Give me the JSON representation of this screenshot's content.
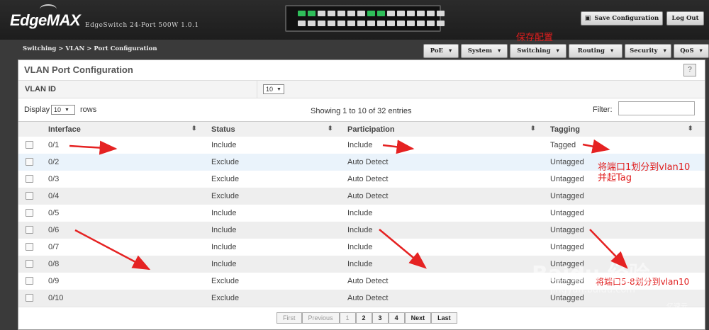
{
  "header": {
    "logo": "EdgeMAX",
    "model": "EdgeSwitch 24-Port 500W 1.0.1",
    "save_label": "Save Configuration",
    "logout_label": "Log Out",
    "save_icon": "floppy-disk-icon",
    "switch_ports_top": [
      1,
      1,
      0,
      0,
      0,
      0,
      0,
      1,
      1,
      0,
      0,
      0,
      0,
      0,
      0
    ],
    "accent_port_color": "#2fbf5a"
  },
  "annotations": {
    "save": "保存配置",
    "port1_line1": "将端口1划分到vlan10",
    "port1_line2": "并起Tag",
    "ports_range": "将端口5-8划分到vlan10"
  },
  "breadcrumb": {
    "a": "Switching",
    "sep1": ">",
    "b": "VLAN",
    "sep2": ">",
    "c": "Port Configuration"
  },
  "menu": [
    {
      "label": "PoE"
    },
    {
      "label": "System"
    },
    {
      "label": "Switching"
    },
    {
      "label": "Routing"
    },
    {
      "label": "Security"
    },
    {
      "label": "QoS"
    }
  ],
  "panel": {
    "title": "VLAN Port Configuration",
    "help": "?",
    "vlan_label": "VLAN ID",
    "vlan_value": "10",
    "display_label": "Display",
    "display_value": "10",
    "rows_label": "rows",
    "showing": "Showing 1 to 10 of 32 entries",
    "filter_label": "Filter:"
  },
  "table": {
    "headers": [
      "Interface",
      "Status",
      "Participation",
      "Tagging"
    ],
    "rows": [
      {
        "iface": "0/1",
        "status": "Include",
        "part": "Include",
        "tag": "Tagged"
      },
      {
        "iface": "0/2",
        "status": "Exclude",
        "part": "Auto Detect",
        "tag": "Untagged"
      },
      {
        "iface": "0/3",
        "status": "Exclude",
        "part": "Auto Detect",
        "tag": "Untagged"
      },
      {
        "iface": "0/4",
        "status": "Exclude",
        "part": "Auto Detect",
        "tag": "Untagged"
      },
      {
        "iface": "0/5",
        "status": "Include",
        "part": "Include",
        "tag": "Untagged"
      },
      {
        "iface": "0/6",
        "status": "Include",
        "part": "Include",
        "tag": "Untagged"
      },
      {
        "iface": "0/7",
        "status": "Include",
        "part": "Include",
        "tag": "Untagged"
      },
      {
        "iface": "0/8",
        "status": "Include",
        "part": "Include",
        "tag": "Untagged"
      },
      {
        "iface": "0/9",
        "status": "Exclude",
        "part": "Auto Detect",
        "tag": "Untagged"
      },
      {
        "iface": "0/10",
        "status": "Exclude",
        "part": "Auto Detect",
        "tag": "Untagged"
      }
    ]
  },
  "pager": [
    "First",
    "Previous",
    "1",
    "2",
    "3",
    "4",
    "Next",
    "Last"
  ],
  "watermark": {
    "brand": "Baidu 经验",
    "url": "jingyan.baidu.com",
    "corner": "亿速云"
  }
}
